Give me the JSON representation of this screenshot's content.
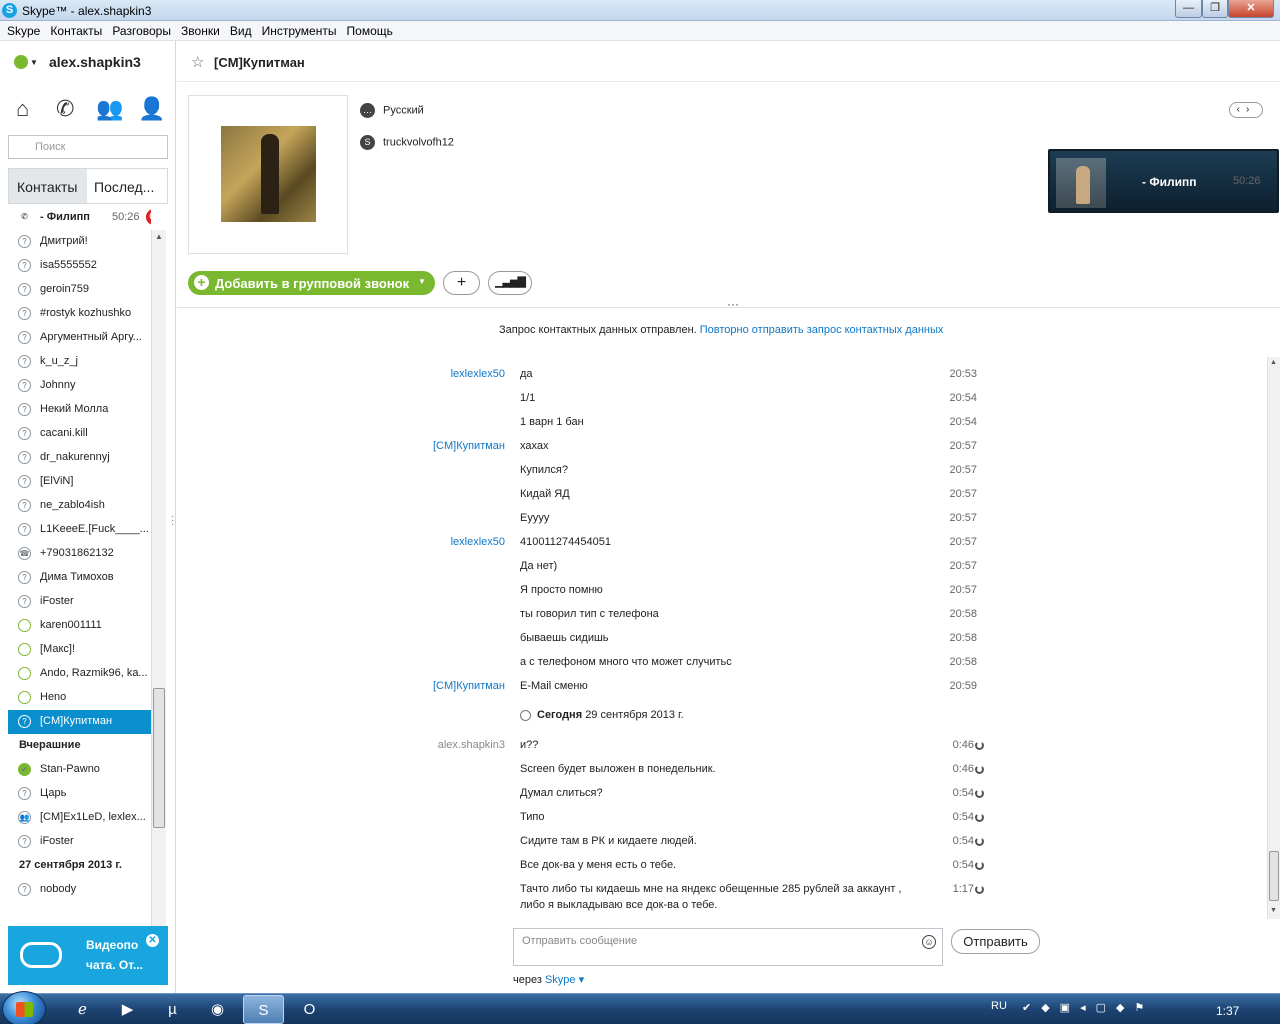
{
  "window": {
    "title": "Skype™ - alex.shapkin3",
    "logo": "S",
    "minimize": "—",
    "maximize": "❐",
    "close": "✕"
  },
  "menu": [
    "Skype",
    "Контакты",
    "Разговоры",
    "Звонки",
    "Вид",
    "Инструменты",
    "Помощь"
  ],
  "account": {
    "name": "alex.shapkin3"
  },
  "search": {
    "placeholder": "Поиск"
  },
  "tabs": {
    "contacts": "Контакты",
    "recent": "Послед..."
  },
  "active_call": {
    "name": "- Филипп",
    "time": "50:26"
  },
  "contacts": [
    {
      "name": "Дмитрий!",
      "status": "offline"
    },
    {
      "name": "isa5555552",
      "status": "offline"
    },
    {
      "name": "geroin759",
      "status": "offline"
    },
    {
      "name": "#rostyk kozhushko",
      "status": "offline"
    },
    {
      "name": "Аргументный Аргу...",
      "status": "offline"
    },
    {
      "name": "k_u_z_j",
      "status": "offline"
    },
    {
      "name": "Johnny",
      "status": "offline"
    },
    {
      "name": "Некий Молла",
      "status": "offline"
    },
    {
      "name": "cacani.kill",
      "status": "offline"
    },
    {
      "name": "dr_nakurennyj",
      "status": "offline"
    },
    {
      "name": "[ElViN]",
      "status": "offline"
    },
    {
      "name": "ne_zablo4ish",
      "status": "offline"
    },
    {
      "name": "L1KeeeE.[Fuck____...",
      "status": "offline"
    },
    {
      "name": "+79031862132",
      "status": "phone"
    },
    {
      "name": "Дима Тимохов",
      "status": "offline"
    },
    {
      "name": "iFoster",
      "status": "offline"
    },
    {
      "name": "karen001111",
      "status": "online-outline"
    },
    {
      "name": "[Макс]!",
      "status": "online-outline"
    },
    {
      "name": "Ando, Razmik96, ka...",
      "status": "online-outline"
    },
    {
      "name": "Heno",
      "status": "online-outline"
    },
    {
      "name": "[CM]Купитман",
      "status": "selected"
    }
  ],
  "group_yesterday": {
    "label": "Вчерашние",
    "items": [
      {
        "name": "Stan-Pawno",
        "status": "online"
      },
      {
        "name": "Царь",
        "status": "offline"
      },
      {
        "name": "[CM]Ex1LeD, lexlex...",
        "status": "group"
      },
      {
        "name": "iFoster",
        "status": "offline"
      }
    ]
  },
  "group_date": {
    "label": "27 сентября 2013 г.",
    "items": [
      {
        "name": "nobody",
        "status": "offline"
      }
    ]
  },
  "promo": {
    "text1": "Видеопо",
    "text2": "чата. От..."
  },
  "conversation": {
    "title": "[CM]Купитман",
    "language": "Русский",
    "skype_name": "truckvolvofh12",
    "add_to_call": "Добавить в групповой звонок",
    "call_name": "- Филипп",
    "call_time": "50:26",
    "notice": "Запрос контактных данных отправлен.",
    "notice_link": "Повторно отправить запрос контактных данных",
    "today_label": "Сегодня",
    "today_date": "29 сентября 2013 г.",
    "input_placeholder": "Отправить сообщение",
    "send": "Отправить",
    "via": "через",
    "via_link": "Skype"
  },
  "messages": [
    {
      "author": "lexlexlex50",
      "text": "да",
      "time": "20:53"
    },
    {
      "author": "",
      "text": "1/1",
      "time": "20:54"
    },
    {
      "author": "",
      "text": "1 варн 1 бан",
      "time": "20:54"
    },
    {
      "author": "[CM]Купитман",
      "text": "хахах",
      "time": "20:57"
    },
    {
      "author": "",
      "text": "Купился?",
      "time": "20:57"
    },
    {
      "author": "",
      "text": "Кидай ЯД",
      "time": "20:57"
    },
    {
      "author": "",
      "text": "Eyyyy",
      "time": "20:57"
    },
    {
      "author": "lexlexlex50",
      "text": "410011274454051",
      "time": "20:57"
    },
    {
      "author": "",
      "text": "Да нет)",
      "time": "20:57"
    },
    {
      "author": "",
      "text": "Я просто помню",
      "time": "20:57"
    },
    {
      "author": "",
      "text": "ты говорил тип с телефона",
      "time": "20:58"
    },
    {
      "author": "",
      "text": "бываешь сидишь",
      "time": "20:58"
    },
    {
      "author": "",
      "text": "а с телефоном много что может случитьс",
      "time": "20:58"
    },
    {
      "author": "[CM]Купитман",
      "text": "E-Mail сменю",
      "time": "20:59"
    }
  ],
  "messages_today": [
    {
      "author": "alex.shapkin3",
      "text": "и??",
      "time": "0:46"
    },
    {
      "author": "",
      "text": "Screen будет выложен в понедельник.",
      "time": "0:46"
    },
    {
      "author": "",
      "text": "Думал слиться?",
      "time": "0:54"
    },
    {
      "author": "",
      "text": "Типо",
      "time": "0:54"
    },
    {
      "author": "",
      "text": "Сидите там в РК и кидаете людей.",
      "time": "0:54"
    },
    {
      "author": "",
      "text": "Все док-ва у меня есть о тебе.",
      "time": "0:54"
    },
    {
      "author": "",
      "text": "Тачто либо ты кидаешь мне на яндекс обещенные 285 рублей за аккаунт ,",
      "text2": "либо я выкладываю все док-ва о тебе.",
      "time": "1:17"
    }
  ],
  "taskbar": {
    "lang": "RU",
    "clock": "1:37"
  }
}
